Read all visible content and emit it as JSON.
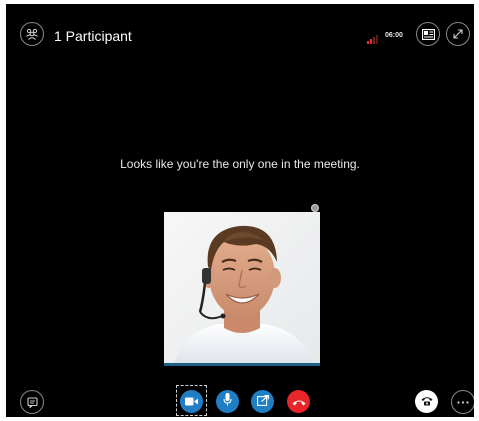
{
  "header": {
    "title": "1 Participant",
    "call_duration": "06:00",
    "icons": {
      "participants": "participants-icon",
      "signal": "signal-strength-icon",
      "layout": "layout-toggle-icon",
      "fullscreen": "fullscreen-expand-icon"
    }
  },
  "stage": {
    "message": "Looks like you're the only one in the meeting."
  },
  "controls": {
    "icons": {
      "chat": "chat-icon",
      "video": "video-camera-icon",
      "mic": "microphone-icon",
      "share": "share-screen-icon",
      "hangup": "hang-up-icon",
      "dialpad": "telephone-dialpad-icon",
      "more": "more-options-icon"
    }
  },
  "colors": {
    "background": "#000000",
    "accent_blue": "#1f7ec4",
    "hangup_red": "#e8262a",
    "signal_red": "#e83030"
  }
}
